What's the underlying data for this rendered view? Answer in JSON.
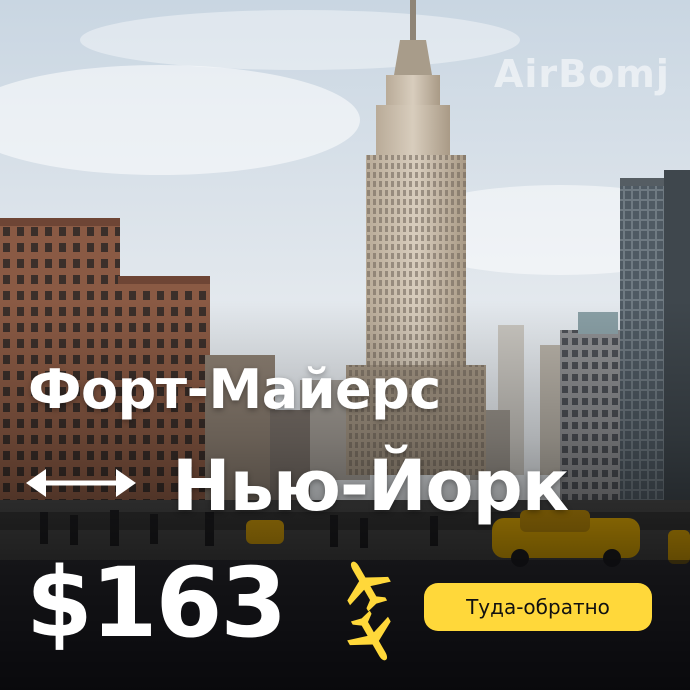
{
  "brand": {
    "watermark": "AirBomj"
  },
  "route": {
    "origin": "Форт-Майерс",
    "destination": "Нью-Йорк",
    "direction_icon": "double-arrow-icon"
  },
  "offer": {
    "price": "$163",
    "trip_type": "Туда-обратно",
    "plane_icons": [
      "airplane-icon",
      "airplane-icon"
    ]
  },
  "colors": {
    "accent": "#ffd83a",
    "text": "#ffffff",
    "taxi": "#f2b705"
  }
}
